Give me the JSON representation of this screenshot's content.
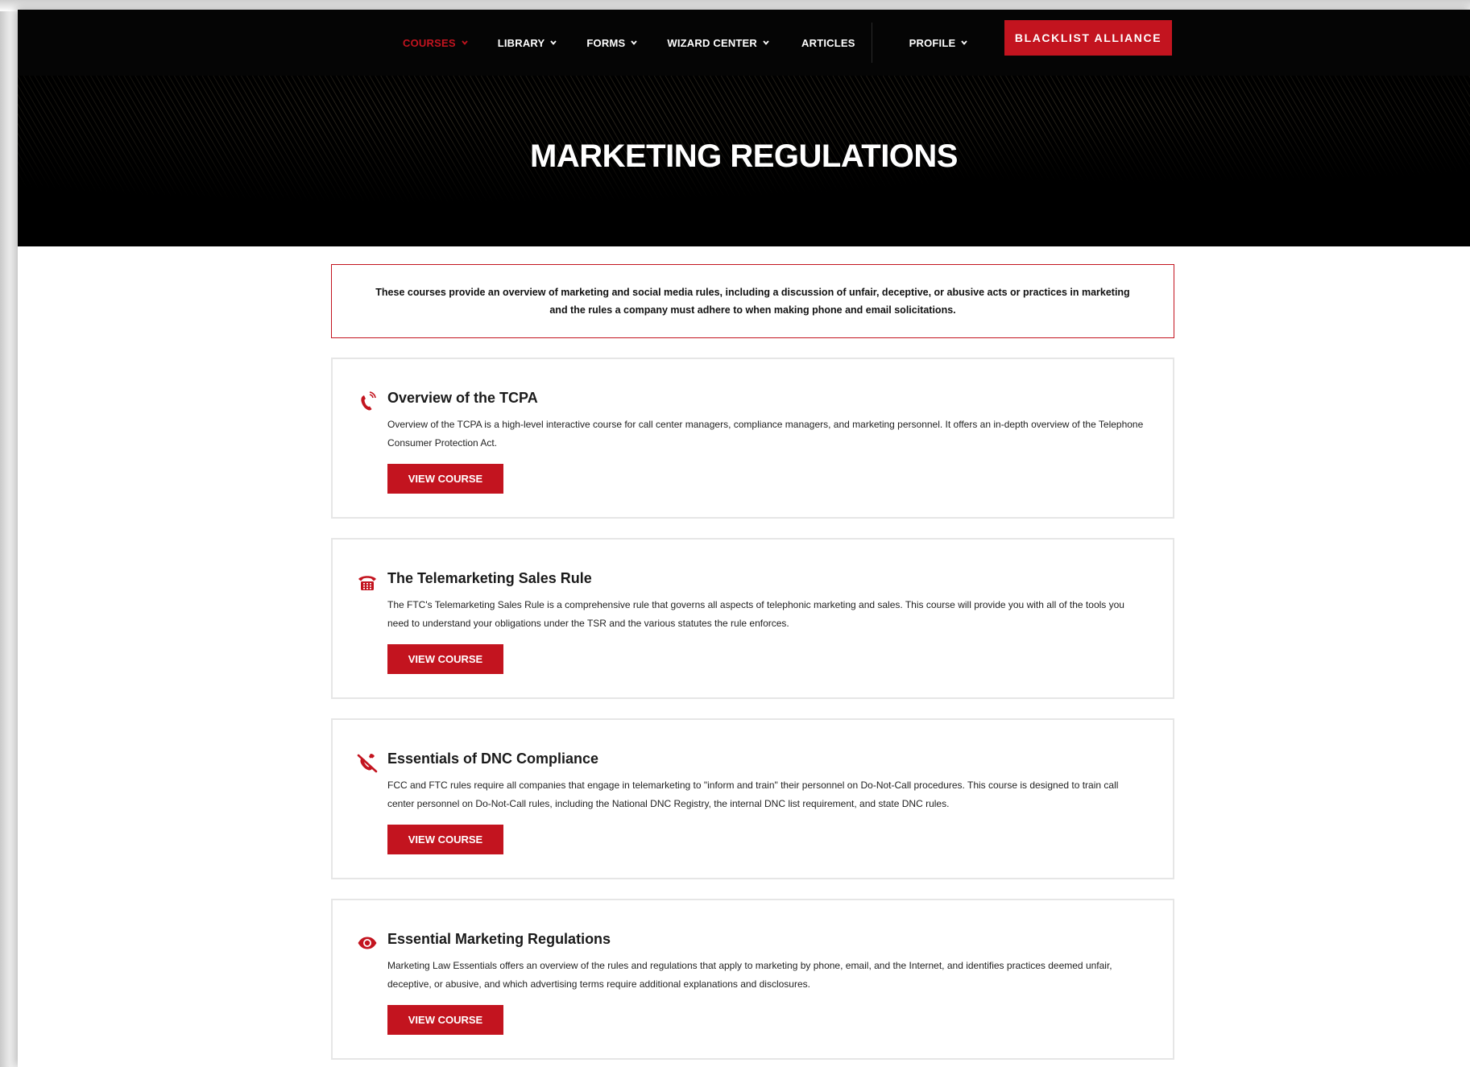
{
  "nav": {
    "items": [
      {
        "label": "COURSES",
        "active": true,
        "dropdown": true,
        "name": "nav-courses"
      },
      {
        "label": "LIBRARY",
        "active": false,
        "dropdown": true,
        "name": "nav-library"
      },
      {
        "label": "FORMS",
        "active": false,
        "dropdown": true,
        "name": "nav-forms"
      },
      {
        "label": "WIZARD CENTER",
        "active": false,
        "dropdown": true,
        "name": "nav-wizard-center"
      },
      {
        "label": "ARTICLES",
        "active": false,
        "dropdown": false,
        "name": "nav-articles"
      }
    ],
    "profile": {
      "label": "PROFILE",
      "dropdown": true
    },
    "cta_label": "BLACKLIST ALLIANCE"
  },
  "hero": {
    "title": "MARKETING REGULATIONS"
  },
  "intro": {
    "text": "These courses provide an overview of marketing and social media rules, including a discussion of unfair, deceptive, or abusive acts or practices in marketing and the rules a company must adhere to when making phone and email solicitations."
  },
  "courses": [
    {
      "title": "Overview of the TCPA",
      "description": "Overview of the TCPA is a high-level interactive course for call center managers, compliance managers, and marketing personnel.  It offers an in-depth overview of the Telephone Consumer Protection Act.",
      "button_label": "VIEW COURSE",
      "icon": "phone-ringing-icon"
    },
    {
      "title": "The Telemarketing Sales Rule",
      "description": "The FTC's Telemarketing Sales Rule is a comprehensive rule that governs all aspects of telephonic marketing and sales. This course will provide you with all of the tools you need to understand your obligations under the TSR and the various statutes the rule enforces.",
      "button_label": "VIEW COURSE",
      "icon": "desk-phone-icon"
    },
    {
      "title": "Essentials of DNC Compliance",
      "description": "FCC and FTC rules require all companies that engage in telemarketing to \"inform and train\" their personnel on Do-Not-Call procedures. This course is designed to train call center personnel on Do-Not-Call rules, including the National DNC Registry, the internal DNC list requirement, and state DNC rules.",
      "button_label": "VIEW COURSE",
      "icon": "phone-blocked-icon"
    },
    {
      "title": "Essential Marketing Regulations",
      "description": "Marketing Law Essentials offers an overview of the rules and regulations that apply to marketing by phone, email, and the Internet, and identifies practices deemed unfair, deceptive, or abusive, and which advertising terms require additional explanations and disclosures.",
      "button_label": "VIEW COURSE",
      "icon": "eye-icon"
    }
  ],
  "colors": {
    "accent": "#c3141f",
    "nav_background": "#050505",
    "hero_background": "#000000",
    "card_border": "#e6e6e6"
  }
}
